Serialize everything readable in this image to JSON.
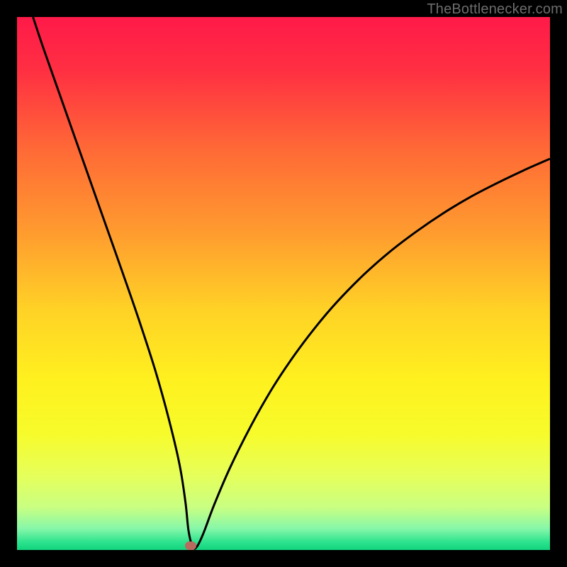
{
  "watermark": "TheBottlenecker.com",
  "colors": {
    "frame": "#000000",
    "gradient_stops": [
      {
        "offset": 0.0,
        "color": "#ff1a49"
      },
      {
        "offset": 0.1,
        "color": "#ff2f42"
      },
      {
        "offset": 0.25,
        "color": "#ff6a36"
      },
      {
        "offset": 0.4,
        "color": "#ff9a2f"
      },
      {
        "offset": 0.55,
        "color": "#ffd226"
      },
      {
        "offset": 0.68,
        "color": "#fff01f"
      },
      {
        "offset": 0.78,
        "color": "#f7fb2a"
      },
      {
        "offset": 0.86,
        "color": "#e6ff5a"
      },
      {
        "offset": 0.92,
        "color": "#c9ff82"
      },
      {
        "offset": 0.96,
        "color": "#86f7a9"
      },
      {
        "offset": 0.985,
        "color": "#2de38e"
      },
      {
        "offset": 1.0,
        "color": "#12d47d"
      }
    ],
    "curve": "#000000",
    "marker": "#b96a5e"
  },
  "chart_data": {
    "type": "line",
    "title": "",
    "xlabel": "",
    "ylabel": "",
    "xlim": [
      0,
      100
    ],
    "ylim": [
      0,
      100
    ],
    "series": [
      {
        "name": "bottleneck-curve",
        "x": [
          3,
          5,
          8,
          11,
          14,
          17,
          20,
          23,
          26,
          28.5,
          30.5,
          31.6,
          32.2,
          33.0,
          33.8,
          35.0,
          37,
          40,
          44,
          48,
          52,
          56,
          60,
          65,
          70,
          75,
          80,
          85,
          90,
          95,
          100
        ],
        "y": [
          100,
          94,
          85.5,
          77,
          68.5,
          60,
          51.5,
          42.8,
          33.5,
          24.5,
          16,
          9,
          3.5,
          0.5,
          0.7,
          3.2,
          8.5,
          15.5,
          23.5,
          30.5,
          36.5,
          41.8,
          46.5,
          51.6,
          56,
          59.8,
          63.2,
          66.2,
          68.8,
          71.2,
          73.4
        ]
      }
    ],
    "marker": {
      "x": 32.6,
      "y": 0.8
    }
  }
}
